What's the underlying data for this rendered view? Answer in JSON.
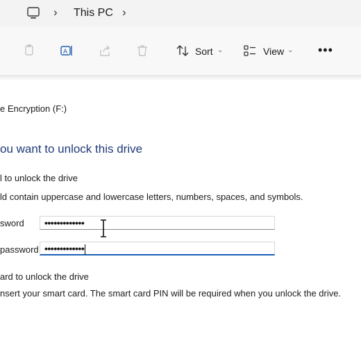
{
  "address_bar": {
    "breadcrumb": "This PC"
  },
  "toolbar": {
    "sort_label": "Sort",
    "view_label": "View",
    "more_label": "•••"
  },
  "dialog": {
    "drive_title": "e Encryption (F:)",
    "heading": "ou want to unlock this drive",
    "password_option": "l to unlock the drive",
    "password_hint": "ld contain uppercase and lowercase letters, numbers, spaces, and symbols.",
    "enter_password_label": "sword",
    "enter_password_value": "•••••••••••••",
    "reenter_password_label": "password",
    "reenter_password_value": "•••••••••••••",
    "smartcard_option": "ard to unlock the drive",
    "smartcard_hint": "nsert your smart card. The smart card PIN will be required when you unlock the drive."
  }
}
